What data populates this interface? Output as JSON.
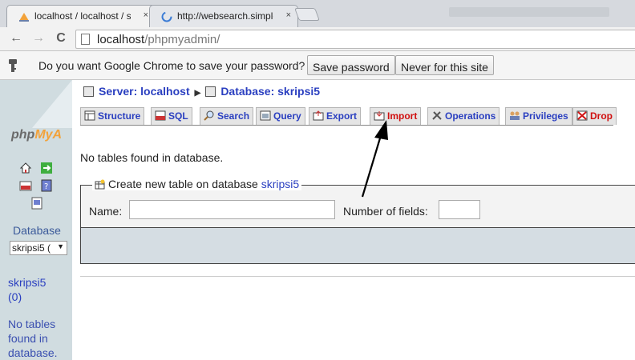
{
  "browser": {
    "tabs": [
      {
        "label": "localhost / localhost / skri",
        "close": "×",
        "active": true
      },
      {
        "label": "http://websearch.simples",
        "close": "×",
        "active": false
      }
    ],
    "url_host": "localhost",
    "url_path": "/phpmyadmin/",
    "nav": {
      "back": "←",
      "forward": "→",
      "reload": "C"
    }
  },
  "infobar": {
    "message": "Do you want Google Chrome to save your password?",
    "save_label": "Save password",
    "never_label": "Never for this site"
  },
  "left": {
    "logo_php": "php",
    "logo_my": "MyA",
    "database_label": "Database",
    "database_select": "skripsi5 (",
    "db_name": "skripsi5",
    "db_count": "(0)",
    "no_tables": "No tables found in database."
  },
  "main": {
    "server_label": "Server: localhost",
    "database_label": "Database: skripsi5",
    "tabs": [
      "Structure",
      "SQL",
      "Search",
      "Query",
      "Export",
      "Import",
      "Operations",
      "Privileges",
      "Drop"
    ],
    "no_tables_msg": "No tables found in database.",
    "create_legend_prefix": "Create new table on database ",
    "create_legend_db": "skripsi5",
    "name_label": "Name:",
    "fields_label": "Number of fields:",
    "name_value": "",
    "fields_value": ""
  },
  "colors": {
    "link": "#2a3fc0",
    "drop": "#d01010",
    "left_frame": "#d0dce0"
  }
}
